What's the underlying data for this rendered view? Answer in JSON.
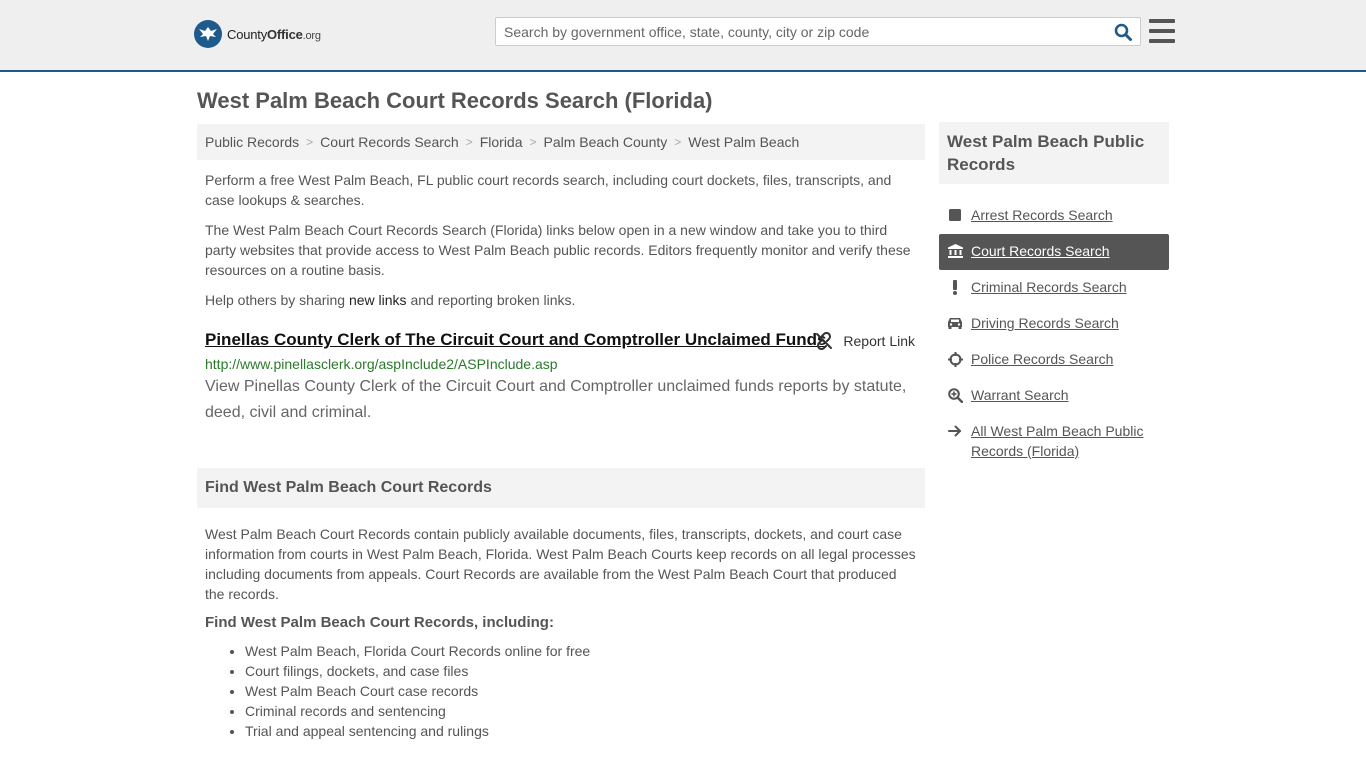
{
  "header": {
    "logo_brand_a": "County",
    "logo_brand_b": "Office",
    "logo_tld": ".org",
    "search_placeholder": "Search by government office, state, county, city or zip code"
  },
  "page": {
    "title": "West Palm Beach Court Records Search (Florida)"
  },
  "breadcrumb": [
    "Public Records",
    "Court Records Search",
    "Florida",
    "Palm Beach County",
    "West Palm Beach"
  ],
  "intro": {
    "p1": "Perform a free West Palm Beach, FL public court records search, including court dockets, files, transcripts, and case lookups & searches.",
    "p2": "The West Palm Beach Court Records Search (Florida) links below open in a new window and take you to third party websites that provide access to West Palm Beach public records. Editors frequently monitor and verify these resources on a routine basis.",
    "p3_before": "Help others by sharing ",
    "p3_link": "new links",
    "p3_after": " and reporting broken links."
  },
  "result": {
    "title": "Pinellas County Clerk of The Circuit Court and Comptroller Unclaimed Funds",
    "report_label": "Report Link",
    "url": "http://www.pinellasclerk.org/aspInclude2/ASPInclude.asp",
    "description": "View Pinellas County Clerk of the Circuit Court and Comptroller unclaimed funds reports by statute, deed, civil and criminal."
  },
  "find_section": {
    "heading": "Find West Palm Beach Court Records",
    "paragraph": "West Palm Beach Court Records contain publicly available documents, files, transcripts, dockets, and court case information from courts in West Palm Beach, Florida. West Palm Beach Courts keep records on all legal processes including documents from appeals. Court Records are available from the West Palm Beach Court that produced the records.",
    "subheading": "Find West Palm Beach Court Records, including:",
    "bullets": [
      "West Palm Beach, Florida Court Records online for free",
      "Court filings, dockets, and case files",
      "West Palm Beach Court case records",
      "Criminal records and sentencing",
      "Trial and appeal sentencing and rulings"
    ]
  },
  "sidebar": {
    "heading": "West Palm Beach Public Records",
    "items": [
      {
        "label": "Arrest Records Search",
        "icon": "square-icon"
      },
      {
        "label": "Court Records Search",
        "icon": "courthouse-icon",
        "active": true
      },
      {
        "label": "Criminal Records Search",
        "icon": "exclamation-icon"
      },
      {
        "label": "Driving Records Search",
        "icon": "car-icon"
      },
      {
        "label": "Police Records Search",
        "icon": "crosshair-icon"
      },
      {
        "label": "Warrant Search",
        "icon": "search-plus-icon"
      },
      {
        "label": "All West Palm Beach Public Records (Florida)",
        "icon": "arrow-right-icon"
      }
    ]
  },
  "colors": {
    "brand": "#1f5a8c",
    "url_green": "#2a7a2a",
    "active_bg": "#555555"
  }
}
